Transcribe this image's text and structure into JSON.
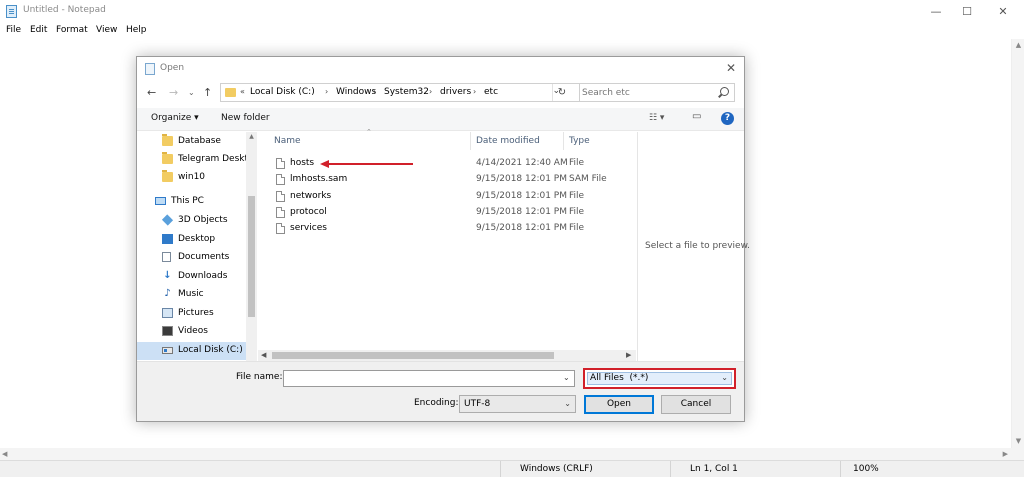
{
  "notepad": {
    "title": "Untitled - Notepad",
    "menu": [
      "File",
      "Edit",
      "Format",
      "View",
      "Help"
    ],
    "window_controls": {
      "minimize": "—",
      "maximize": "☐",
      "close": "✕"
    },
    "status": {
      "line_ending": "Windows (CRLF)",
      "position": "Ln 1, Col 1",
      "zoom": "100%"
    }
  },
  "dialog": {
    "title": "Open",
    "address": {
      "overflow": "«",
      "parts": [
        "Local Disk (C:)",
        "Windows",
        "System32",
        "drivers",
        "etc"
      ],
      "separator": "›"
    },
    "search": {
      "placeholder": "Search etc"
    },
    "commands": {
      "organize": "Organize ▾",
      "new_folder": "New folder",
      "help": "?"
    },
    "nav_items": [
      {
        "label": "Database",
        "icon": "folder-icon"
      },
      {
        "label": "Telegram Deskto",
        "icon": "folder-icon"
      },
      {
        "label": "win10",
        "icon": "folder-icon"
      },
      {
        "label": "This PC",
        "icon": "computer-icon"
      },
      {
        "label": "3D Objects",
        "icon": "3d-objects-icon"
      },
      {
        "label": "Desktop",
        "icon": "desktop-icon"
      },
      {
        "label": "Documents",
        "icon": "documents-icon"
      },
      {
        "label": "Downloads",
        "icon": "downloads-icon"
      },
      {
        "label": "Music",
        "icon": "music-icon"
      },
      {
        "label": "Pictures",
        "icon": "pictures-icon"
      },
      {
        "label": "Videos",
        "icon": "videos-icon"
      },
      {
        "label": "Local Disk (C:)",
        "icon": "local-disk-icon"
      }
    ],
    "columns": {
      "name": "Name",
      "date": "Date modified",
      "type": "Type"
    },
    "files": [
      {
        "name": "hosts",
        "date": "4/14/2021 12:40 AM",
        "type": "File"
      },
      {
        "name": "lmhosts.sam",
        "date": "9/15/2018 12:01 PM",
        "type": "SAM File"
      },
      {
        "name": "networks",
        "date": "9/15/2018 12:01 PM",
        "type": "File"
      },
      {
        "name": "protocol",
        "date": "9/15/2018 12:01 PM",
        "type": "File"
      },
      {
        "name": "services",
        "date": "9/15/2018 12:01 PM",
        "type": "File"
      }
    ],
    "preview_text": "Select a file to preview.",
    "file_name_label": "File name:",
    "file_name_value": "",
    "file_type_filter": "All Files  (*.*)",
    "encoding_label": "Encoding:",
    "encoding_value": "UTF-8",
    "open_button": "Open",
    "cancel_button": "Cancel",
    "highlight_color": "#d1202a"
  }
}
